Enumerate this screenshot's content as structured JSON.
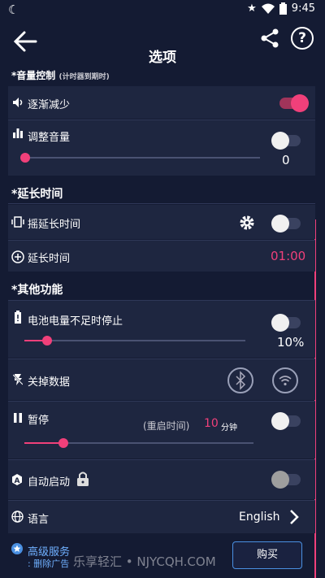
{
  "status_bar": {
    "time": "9:45"
  },
  "app_bar": {
    "title": "选项",
    "help_label": "?"
  },
  "volume_section": {
    "title": "*音量控制",
    "subtitle": "(计时器到期时)",
    "fade_out": {
      "label": "逐渐减少",
      "enabled": true
    },
    "adjust_volume": {
      "label": "调整音量",
      "enabled": false,
      "value": "0",
      "level": 0
    }
  },
  "extend_section": {
    "title": "*延长时间",
    "shake_extend": {
      "label": "摇延长时间",
      "enabled": false
    },
    "extend_time": {
      "label": "延长时间",
      "value": "01:00"
    }
  },
  "other_section": {
    "title": "*其他功能",
    "battery_stop": {
      "label": "电池电量不足时停止",
      "enabled": false,
      "value": "10%",
      "level": 0.1
    },
    "disable_data": {
      "label": "关掉数据"
    },
    "pause": {
      "label": "暂停",
      "enabled": false,
      "restart_label": "(重启时间)",
      "minutes": "10",
      "unit": "分钟",
      "level": 0.18
    },
    "auto_start": {
      "label": "自动启动",
      "enabled": false
    },
    "language": {
      "label": "语言",
      "value": "English"
    }
  },
  "premium": {
    "title": "高级服务",
    "subtitle": ": 删除广告",
    "buy_label": "购买"
  },
  "watermark": "乐享轻汇 • NJYCQH.COM",
  "colors": {
    "accent": "#f0407a",
    "background": "#141b33",
    "card": "#1e2640"
  }
}
